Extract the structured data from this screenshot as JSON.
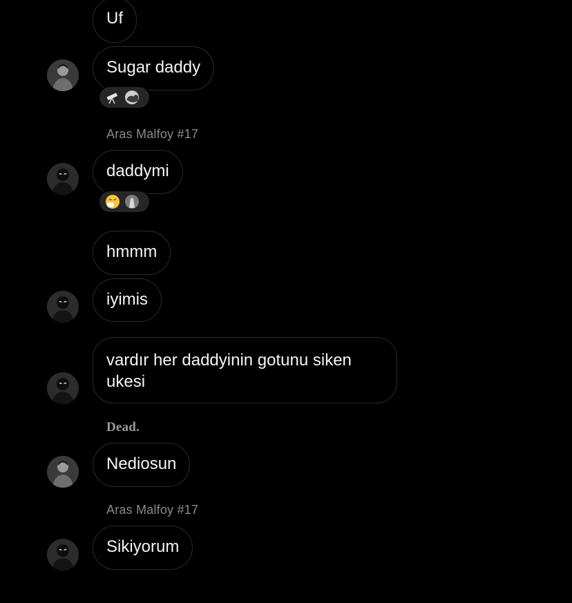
{
  "messages": [
    {
      "text": "Uf"
    },
    {
      "text": "Sugar daddy",
      "reactions": [
        "telescope-emoji",
        "photo-reaction"
      ]
    },
    {
      "text": "daddymi",
      "reactions": [
        "sneezing-face-emoji",
        "photo-reaction"
      ]
    },
    {
      "text": "hmmm"
    },
    {
      "text": "iyimis"
    },
    {
      "text": "vardır her daddyinin gotunu siken ukesi"
    },
    {
      "text": "Nediosun"
    },
    {
      "text": "Sikiyorum"
    }
  ],
  "senders": [
    {
      "name": "Aras Malfoy #17"
    },
    {
      "name": "Dead."
    },
    {
      "name": "Aras Malfoy #17"
    }
  ],
  "colors": {
    "background": "#000000",
    "bubble_border": "#2b2b2b",
    "text": "#f4f4f4",
    "sender_text": "#8a8a8a",
    "reaction_pill": "#262626"
  }
}
